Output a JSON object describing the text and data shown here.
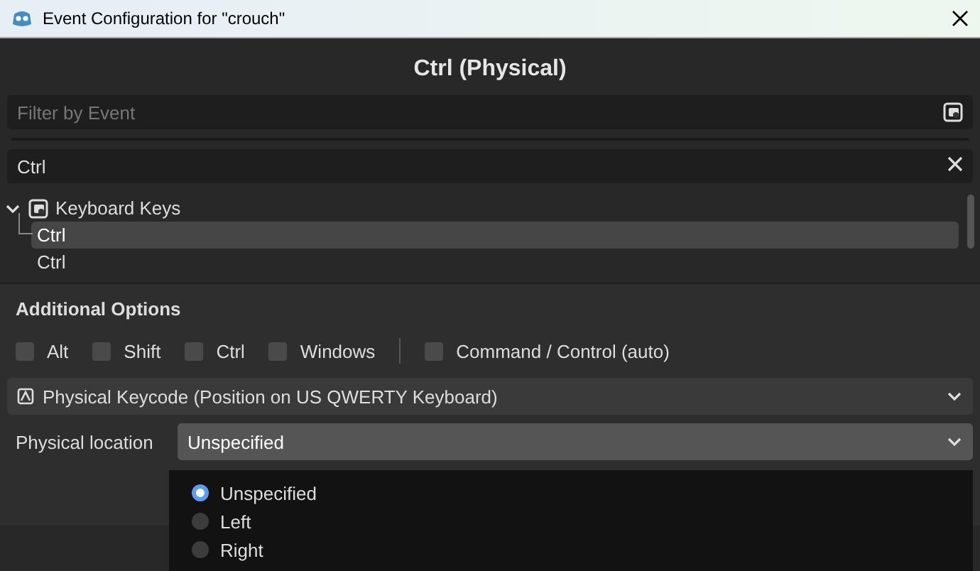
{
  "window": {
    "title": "Event Configuration for \"crouch\""
  },
  "event_title": "Ctrl (Physical)",
  "filter": {
    "placeholder": "Filter by Event"
  },
  "search": {
    "value": "Ctrl"
  },
  "tree": [
    {
      "label": "Keyboard Keys",
      "expanded": true,
      "children": [
        {
          "label": "Ctrl",
          "selected": true
        },
        {
          "label": "Ctrl",
          "selected": false
        }
      ]
    }
  ],
  "additional_options": {
    "title": "Additional Options",
    "modifiers": [
      {
        "label": "Alt",
        "checked": false
      },
      {
        "label": "Shift",
        "checked": false
      },
      {
        "label": "Ctrl",
        "checked": false
      },
      {
        "label": "Windows",
        "checked": false
      }
    ],
    "command_control": {
      "label": "Command / Control (auto)",
      "checked": false
    },
    "keycode_mode": {
      "value": "Physical Keycode (Position on US QWERTY Keyboard)"
    },
    "physical_location": {
      "label": "Physical location",
      "value": "Unspecified",
      "expanded": true,
      "options": [
        {
          "label": "Unspecified",
          "selected": true
        },
        {
          "label": "Left",
          "selected": false
        },
        {
          "label": "Right",
          "selected": false
        }
      ]
    }
  }
}
